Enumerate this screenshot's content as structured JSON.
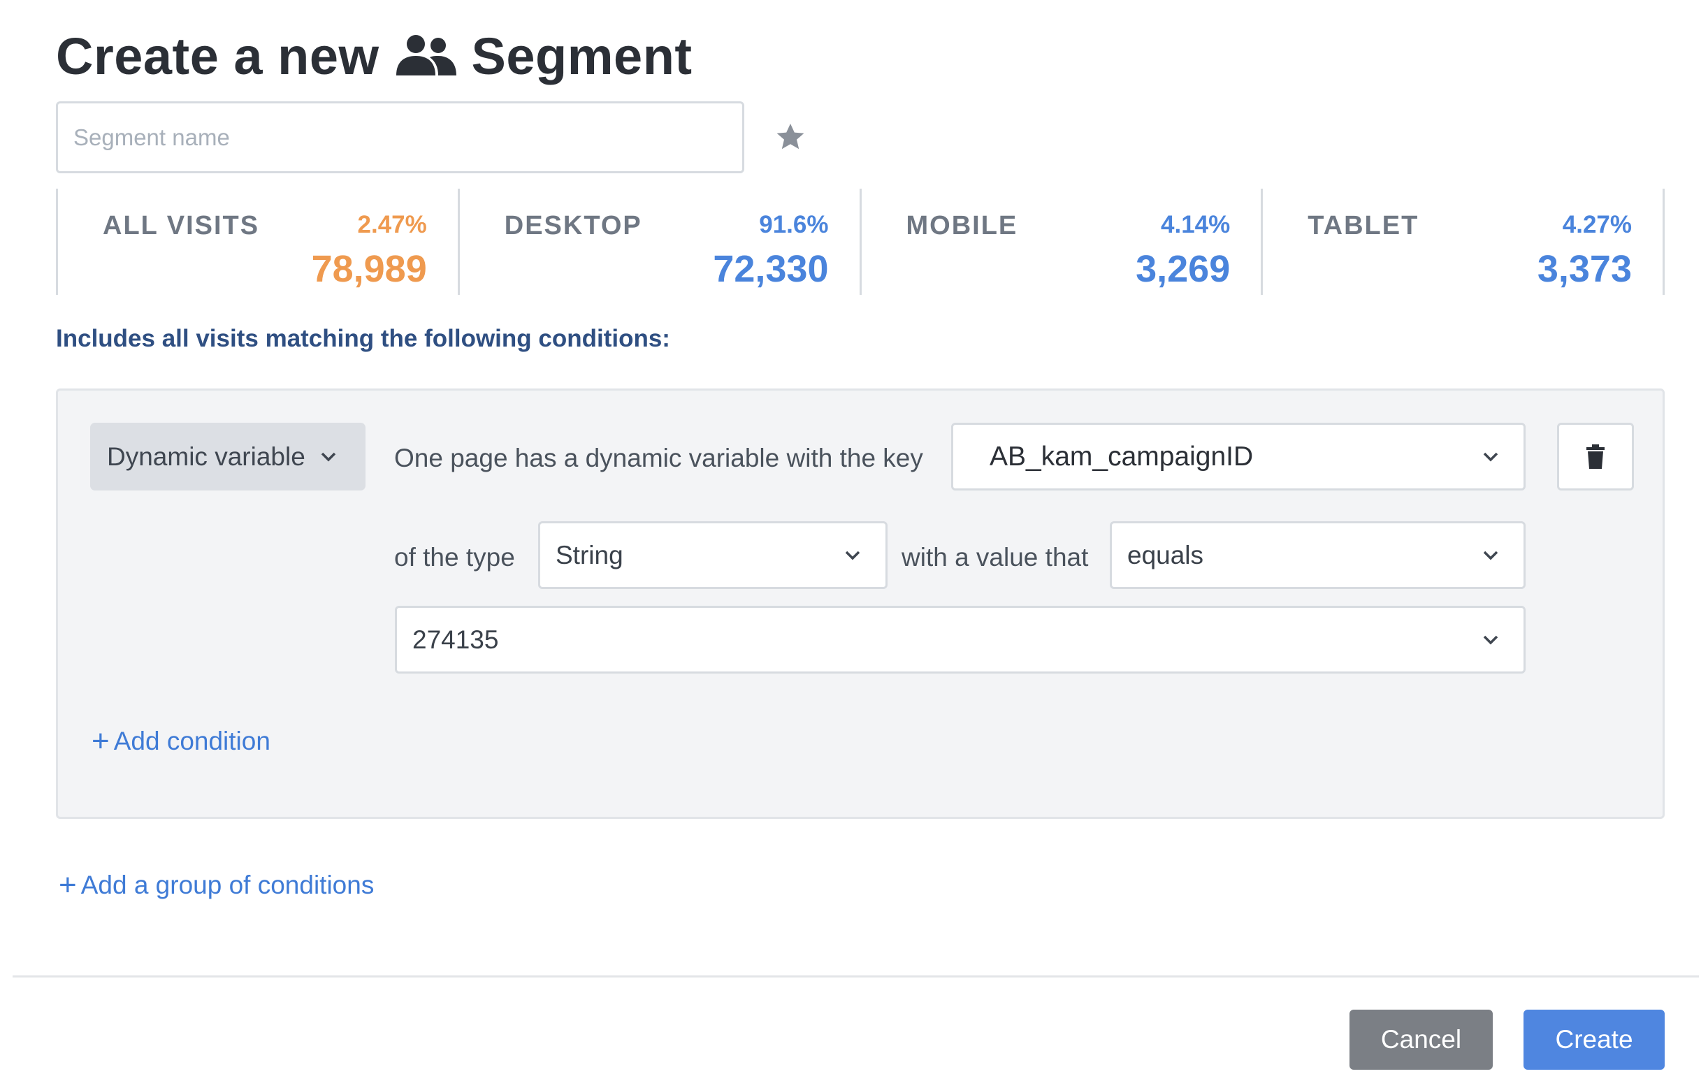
{
  "header": {
    "title_prefix": "Create a new",
    "title_suffix": "Segment",
    "title_icon": "people-icon"
  },
  "segment_name": {
    "placeholder": "Segment name",
    "value": "",
    "favorite_icon": "star-icon"
  },
  "stats": [
    {
      "label": "ALL VISITS",
      "percent": "2.47%",
      "count": "78,989",
      "color": "#ef9a4f"
    },
    {
      "label": "DESKTOP",
      "percent": "91.6%",
      "count": "72,330",
      "color": "#4a84dc"
    },
    {
      "label": "MOBILE",
      "percent": "4.14%",
      "count": "3,269",
      "color": "#4a84dc"
    },
    {
      "label": "TABLET",
      "percent": "4.27%",
      "count": "3,373",
      "color": "#4a84dc"
    }
  ],
  "conditions_label": "Includes all visits matching the following conditions:",
  "condition": {
    "type_button": "Dynamic variable",
    "sentence_1": "One page has a dynamic variable with the key",
    "key_value": "AB_kam_campaignID",
    "sentence_2": "of the type",
    "data_type": "String",
    "sentence_3": "with a value that",
    "operator": "equals",
    "value": "274135",
    "delete_icon": "trash-icon"
  },
  "add_condition": "Add condition",
  "add_group": "Add a group of conditions",
  "footer": {
    "cancel": "Cancel",
    "create": "Create"
  }
}
